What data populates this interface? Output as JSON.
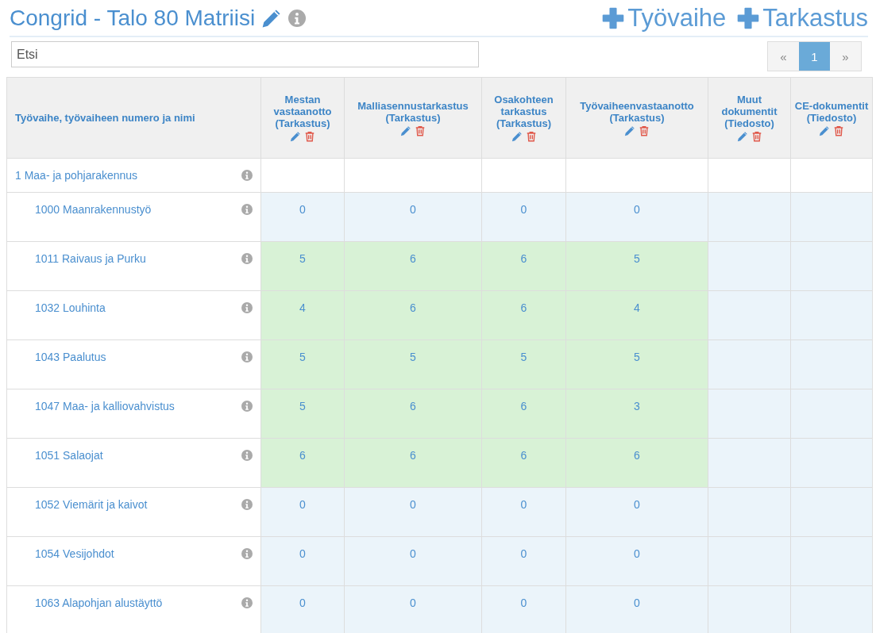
{
  "header": {
    "title": "Congrid - Talo 80 Matriisi",
    "actions": [
      {
        "label": "Työvaihe"
      },
      {
        "label": "Tarkastus"
      }
    ]
  },
  "search": {
    "placeholder": "Etsi"
  },
  "pagination": {
    "prev": "«",
    "next": "»",
    "pages": [
      {
        "label": "1",
        "selected": true
      }
    ]
  },
  "table": {
    "columns": [
      {
        "label": "Työvaihe, työvaiheen numero ja nimi"
      },
      {
        "label": "Mestan vastaanotto (Tarkastus)"
      },
      {
        "label": "Malliasennustarkastus (Tarkastus)"
      },
      {
        "label": "Osakohteen tarkastus (Tarkastus)"
      },
      {
        "label": "Työvaiheenvastaanotto (Tarkastus)"
      },
      {
        "label": "Muut dokumentit (Tiedosto)"
      },
      {
        "label": "CE-dokumentit (Tiedosto)"
      }
    ],
    "rows": [
      {
        "name": "1 Maa- ja pohjarakennus",
        "cells": [
          {
            "color": "#ffffff"
          },
          {
            "color": "#ffffff"
          },
          {
            "color": "#ffffff"
          },
          {
            "color": "#ffffff"
          },
          {
            "color": "#ffffff"
          },
          {
            "color": "#ffffff"
          }
        ],
        "children": [
          {
            "name": "1000 Maanrakennustyö",
            "cells": [
              {
                "text": "0",
                "color": "#ebf4fa"
              },
              {
                "text": "0",
                "color": "#ebf4fa"
              },
              {
                "text": "0",
                "color": "#ebf4fa"
              },
              {
                "text": "0",
                "color": "#ebf4fa"
              },
              {
                "color": "#ebf4fa"
              },
              {
                "color": "#ebf4fa"
              }
            ]
          },
          {
            "name": "1011 Raivaus ja Purku",
            "cells": [
              {
                "text": "5",
                "color": "#d8f2d6"
              },
              {
                "text": "6",
                "color": "#d8f2d6"
              },
              {
                "text": "6",
                "color": "#d8f2d6"
              },
              {
                "text": "5",
                "color": "#d8f2d6"
              },
              {
                "color": "#ebf4fa"
              },
              {
                "color": "#ebf4fa"
              }
            ]
          },
          {
            "name": "1032 Louhinta",
            "cells": [
              {
                "text": "4",
                "color": "#d8f2d6"
              },
              {
                "text": "6",
                "color": "#d8f2d6"
              },
              {
                "text": "6",
                "color": "#d8f2d6"
              },
              {
                "text": "4",
                "color": "#d8f2d6"
              },
              {
                "color": "#ebf4fa"
              },
              {
                "color": "#ebf4fa"
              }
            ]
          },
          {
            "name": "1043 Paalutus",
            "cells": [
              {
                "text": "5",
                "color": "#d8f2d6"
              },
              {
                "text": "5",
                "color": "#d8f2d6"
              },
              {
                "text": "5",
                "color": "#d8f2d6"
              },
              {
                "text": "5",
                "color": "#d8f2d6"
              },
              {
                "color": "#ebf4fa"
              },
              {
                "color": "#ebf4fa"
              }
            ]
          },
          {
            "name": "1047 Maa- ja kalliovahvistus",
            "cells": [
              {
                "text": "5",
                "color": "#d8f2d6"
              },
              {
                "text": "6",
                "color": "#d8f2d6"
              },
              {
                "text": "6",
                "color": "#d8f2d6"
              },
              {
                "text": "3",
                "color": "#d8f2d6"
              },
              {
                "color": "#ebf4fa"
              },
              {
                "color": "#ebf4fa"
              }
            ]
          },
          {
            "name": "1051 Salaojat",
            "cells": [
              {
                "text": "6",
                "color": "#d8f2d6"
              },
              {
                "text": "6",
                "color": "#d8f2d6"
              },
              {
                "text": "6",
                "color": "#d8f2d6"
              },
              {
                "text": "6",
                "color": "#d8f2d6"
              },
              {
                "color": "#ebf4fa"
              },
              {
                "color": "#ebf4fa"
              }
            ]
          },
          {
            "name": "1052 Viemärit ja kaivot",
            "cells": [
              {
                "text": "0",
                "color": "#ebf4fa"
              },
              {
                "text": "0",
                "color": "#ebf4fa"
              },
              {
                "text": "0",
                "color": "#ebf4fa"
              },
              {
                "text": "0",
                "color": "#ebf4fa"
              },
              {
                "color": "#ebf4fa"
              },
              {
                "color": "#ebf4fa"
              }
            ]
          },
          {
            "name": "1054 Vesijohdot",
            "cells": [
              {
                "text": "0",
                "color": "#ebf4fa"
              },
              {
                "text": "0",
                "color": "#ebf4fa"
              },
              {
                "text": "0",
                "color": "#ebf4fa"
              },
              {
                "text": "0",
                "color": "#ebf4fa"
              },
              {
                "color": "#ebf4fa"
              },
              {
                "color": "#ebf4fa"
              }
            ]
          },
          {
            "name": "1063 Alapohjan alustäyttö",
            "cells": [
              {
                "text": "0",
                "color": "#ebf4fa"
              },
              {
                "text": "0",
                "color": "#ebf4fa"
              },
              {
                "text": "0",
                "color": "#ebf4fa"
              },
              {
                "text": "0",
                "color": "#ebf4fa"
              },
              {
                "color": "#ebf4fa"
              },
              {
                "color": "#ebf4fa"
              }
            ]
          }
        ]
      }
    ]
  }
}
